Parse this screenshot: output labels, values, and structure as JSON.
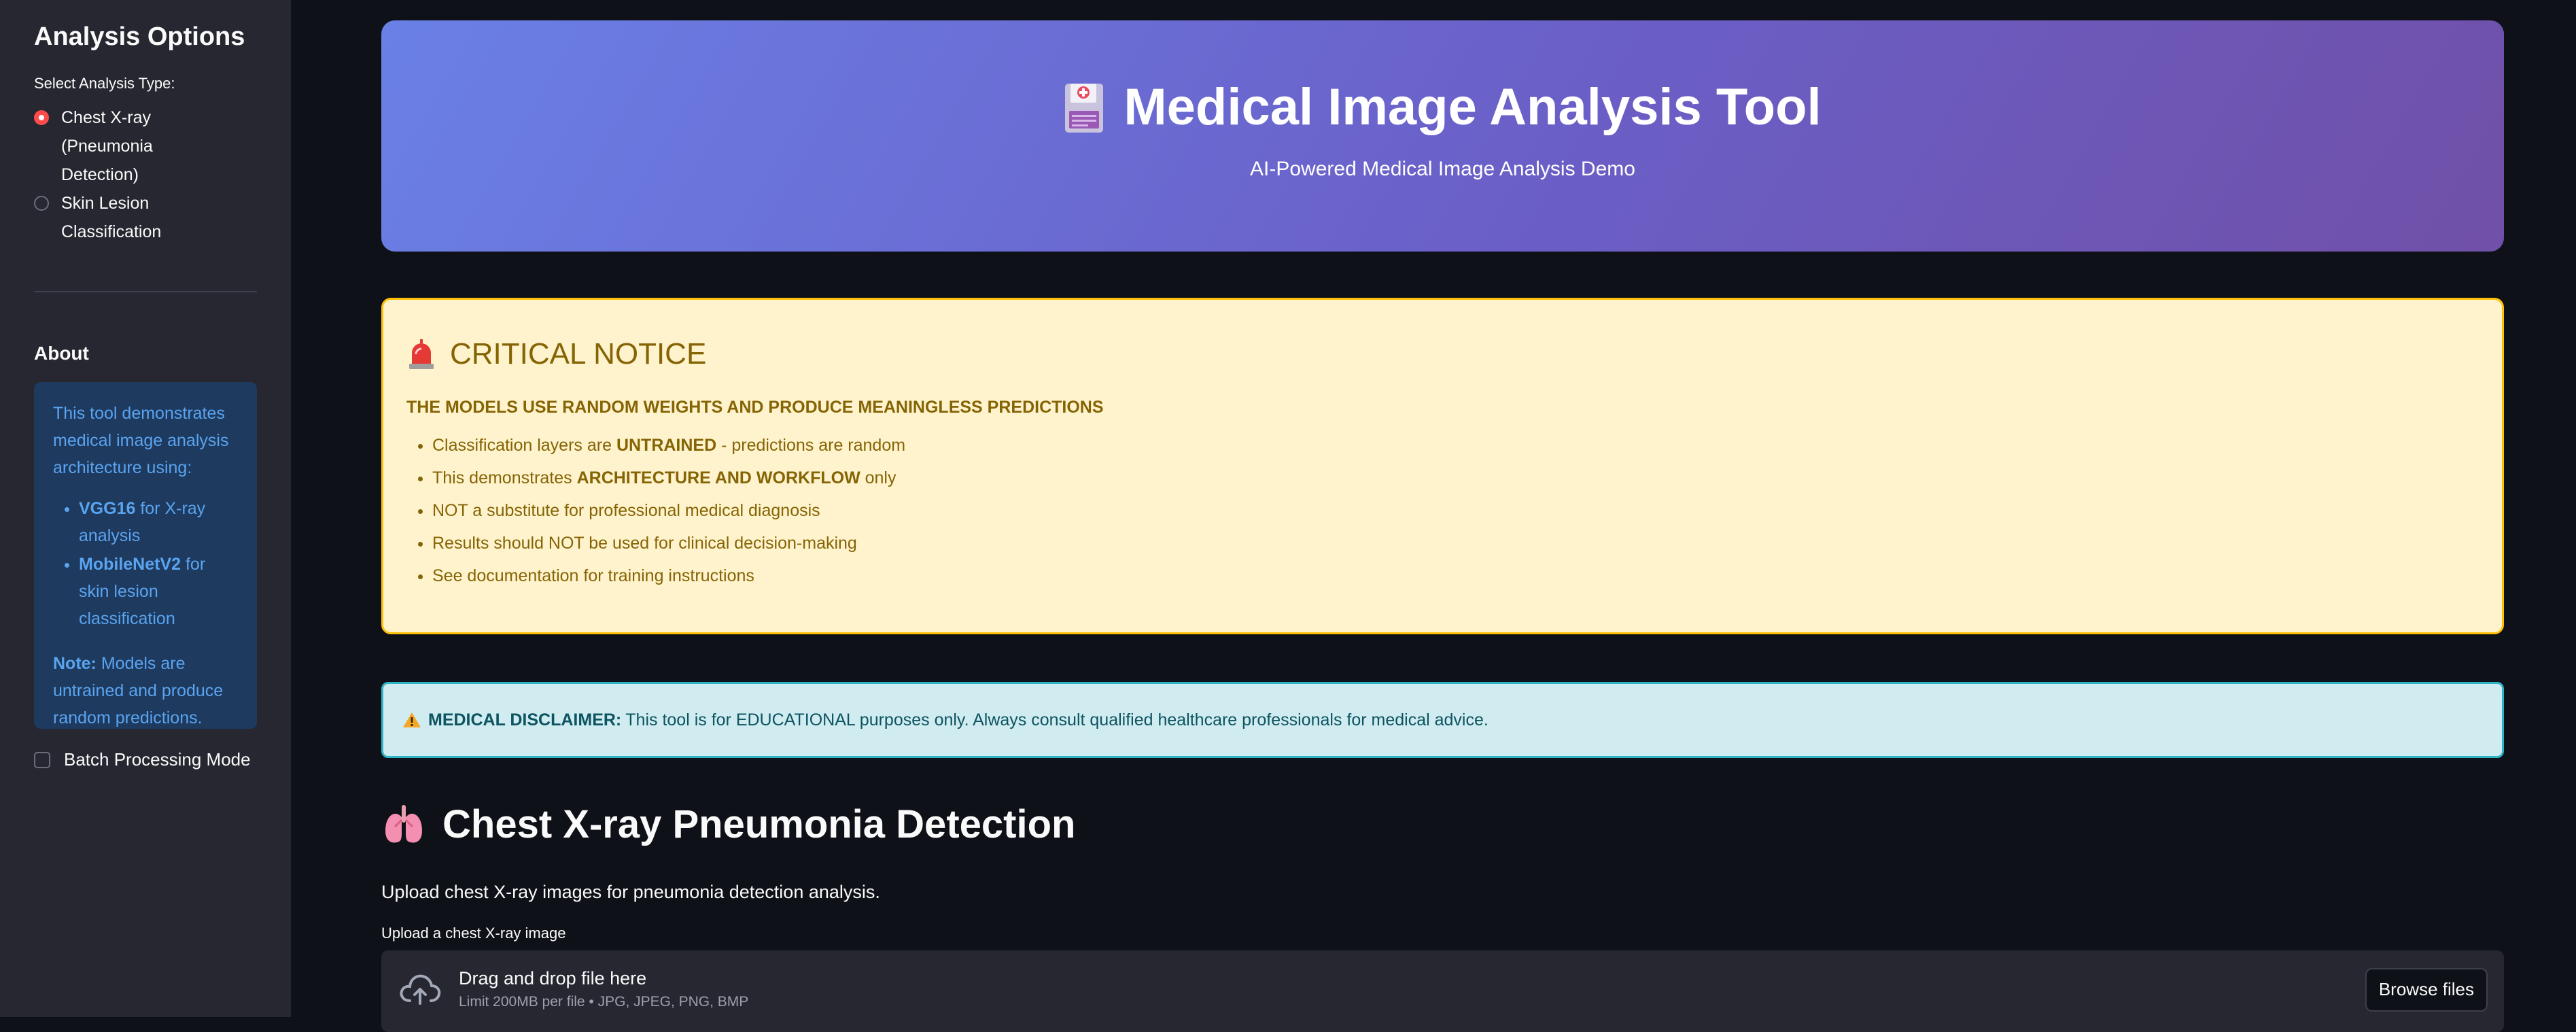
{
  "sidebar": {
    "title": "Analysis Options",
    "analysis_label": "Select Analysis Type:",
    "options": [
      {
        "label": "Chest X-ray (Pneumonia Detection)",
        "selected": true
      },
      {
        "label": "Skin Lesion Classification",
        "selected": false
      }
    ],
    "about_title": "About",
    "about": {
      "intro": "This tool demonstrates medical image analysis architecture using:",
      "items": [
        {
          "bold": "VGG16",
          "text": " for X-ray analysis"
        },
        {
          "bold": "MobileNetV2",
          "text": " for skin lesion classification"
        }
      ],
      "note_label": "Note:",
      "note_text": " Models are untrained and produce random predictions."
    },
    "batch_label": "Batch Processing Mode",
    "batch_checked": false
  },
  "hero": {
    "title": "Medical Image Analysis Tool",
    "subtitle": "AI-Powered Medical Image Analysis Demo",
    "icon": "floppy-disk-medical-icon"
  },
  "notice": {
    "icon": "siren-icon",
    "title": "CRITICAL NOTICE",
    "headline": "THE MODELS USE RANDOM WEIGHTS AND PRODUCE MEANINGLESS PREDICTIONS",
    "bullets": [
      {
        "pre": "Classification layers are ",
        "bold": "UNTRAINED",
        "post": " - predictions are random"
      },
      {
        "pre": "This demonstrates ",
        "bold": "ARCHITECTURE AND WORKFLOW",
        "post": " only"
      },
      {
        "pre": "NOT a substitute for professional medical diagnosis",
        "bold": "",
        "post": ""
      },
      {
        "pre": "Results should NOT be used for clinical decision-making",
        "bold": "",
        "post": ""
      },
      {
        "pre": "See documentation for training instructions",
        "bold": "",
        "post": ""
      }
    ]
  },
  "disclaimer": {
    "icon": "warning-icon",
    "label": "MEDICAL DISCLAIMER:",
    "text": "This tool is for EDUCATIONAL purposes only. Always consult qualified healthcare professionals for medical advice."
  },
  "section": {
    "icon": "lungs-icon",
    "title": "Chest X-ray Pneumonia Detection",
    "description": "Upload chest X-ray images for pneumonia detection analysis."
  },
  "uploader": {
    "label": "Upload a chest X-ray image",
    "drop_text": "Drag and drop file here",
    "limit_text": "Limit 200MB per file • JPG, JPEG, PNG, BMP",
    "button": "Browse files"
  },
  "colors": {
    "accent": "#ff4b4b",
    "sidebar_bg": "#262730",
    "app_bg": "#0e1117",
    "hero_gradient_start": "#6a80e6",
    "hero_gradient_end": "#7050a8",
    "warning_bg": "#fff3cd",
    "warning_border": "#ffc107",
    "info_bg": "#d1ecf1"
  }
}
